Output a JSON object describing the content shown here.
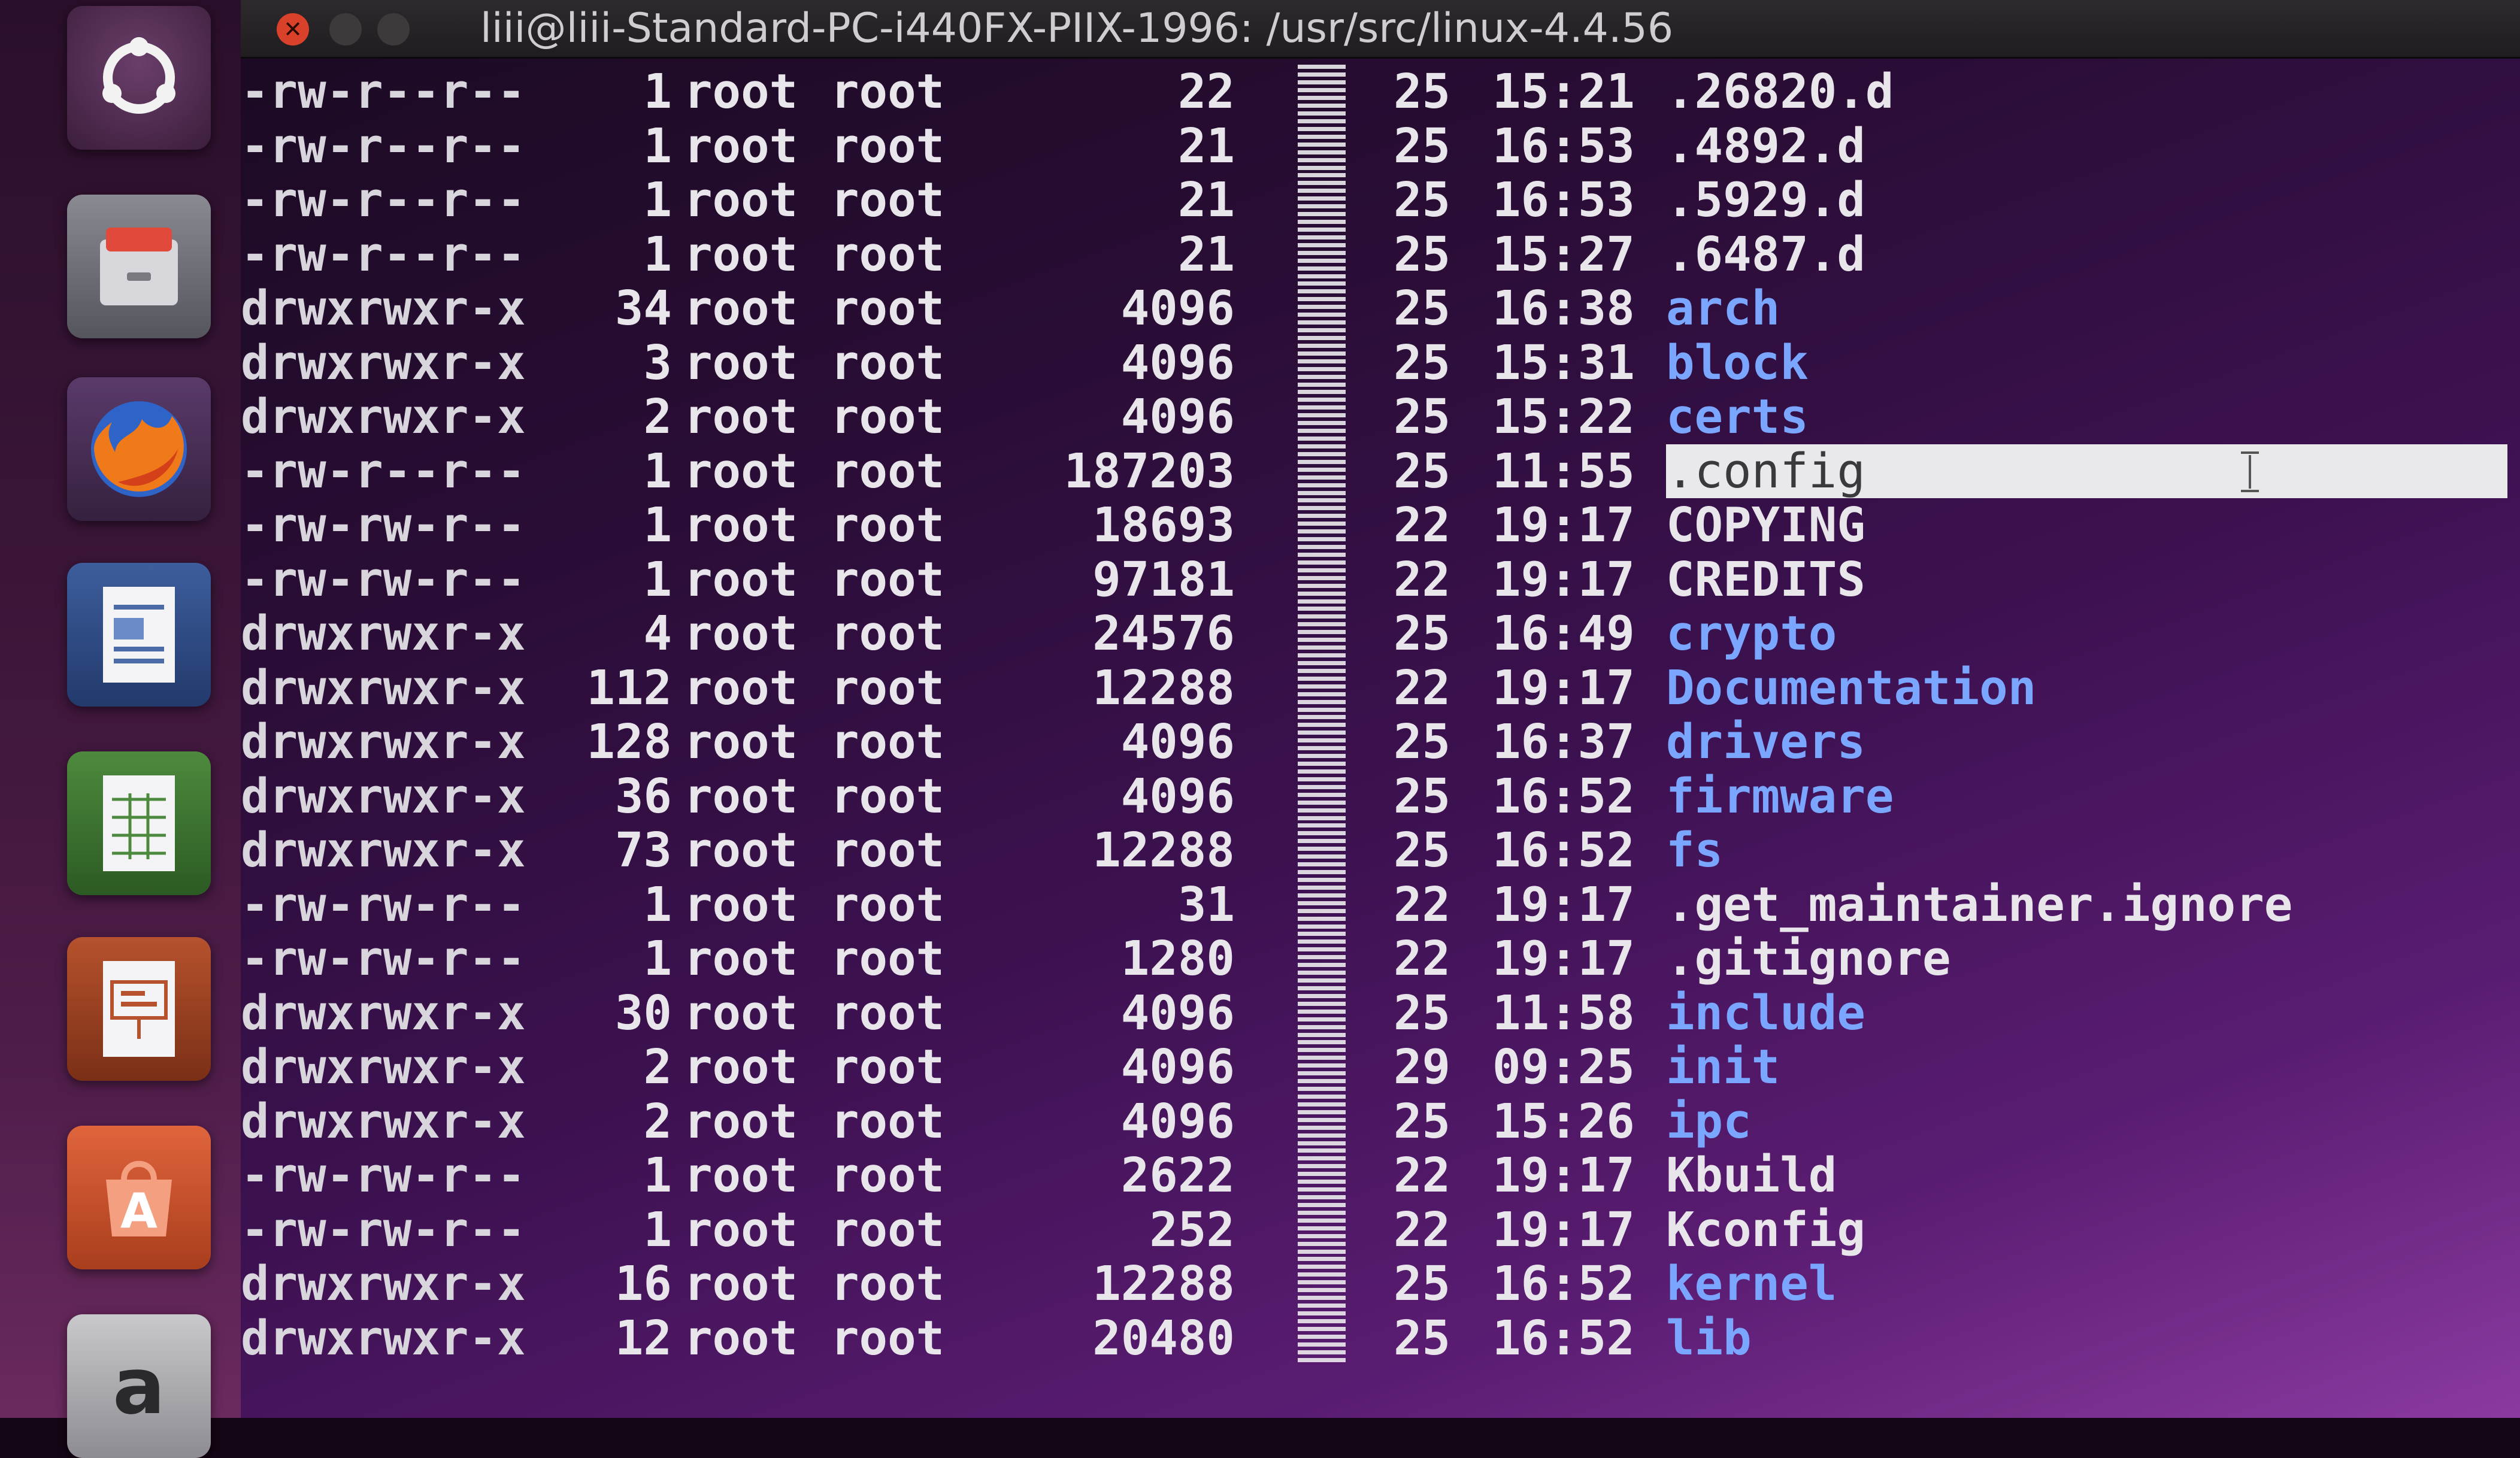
{
  "window": {
    "title": "liii@liii-Standard-PC-i440FX-PIIX-1996: /usr/src/linux-4.4.56",
    "close_glyph": "✕"
  },
  "launcher": {
    "items": [
      {
        "name": "dash-icon"
      },
      {
        "name": "files-icon"
      },
      {
        "name": "firefox-icon"
      },
      {
        "name": "writer-icon"
      },
      {
        "name": "calc-icon"
      },
      {
        "name": "impress-icon"
      },
      {
        "name": "software-center-icon"
      },
      {
        "name": "amazon-icon"
      }
    ]
  },
  "colors": {
    "directory": "#7aa6ff",
    "file": "#e8e6ea",
    "selection_bg": "#e9e9ec"
  },
  "listing": {
    "rows": [
      {
        "perm": "-rw-r--r--",
        "links": "1",
        "owner": "root",
        "group": "root",
        "size": "22",
        "day": "25",
        "time": "15:21",
        "name": ".26820.d",
        "type": "file"
      },
      {
        "perm": "-rw-r--r--",
        "links": "1",
        "owner": "root",
        "group": "root",
        "size": "21",
        "day": "25",
        "time": "16:53",
        "name": ".4892.d",
        "type": "file"
      },
      {
        "perm": "-rw-r--r--",
        "links": "1",
        "owner": "root",
        "group": "root",
        "size": "21",
        "day": "25",
        "time": "16:53",
        "name": ".5929.d",
        "type": "file"
      },
      {
        "perm": "-rw-r--r--",
        "links": "1",
        "owner": "root",
        "group": "root",
        "size": "21",
        "day": "25",
        "time": "15:27",
        "name": ".6487.d",
        "type": "file"
      },
      {
        "perm": "drwxrwxr-x",
        "links": "34",
        "owner": "root",
        "group": "root",
        "size": "4096",
        "day": "25",
        "time": "16:38",
        "name": "arch",
        "type": "dir"
      },
      {
        "perm": "drwxrwxr-x",
        "links": "3",
        "owner": "root",
        "group": "root",
        "size": "4096",
        "day": "25",
        "time": "15:31",
        "name": "block",
        "type": "dir"
      },
      {
        "perm": "drwxrwxr-x",
        "links": "2",
        "owner": "root",
        "group": "root",
        "size": "4096",
        "day": "25",
        "time": "15:22",
        "name": "certs",
        "type": "dir"
      },
      {
        "perm": "-rw-r--r--",
        "links": "1",
        "owner": "root",
        "group": "root",
        "size": "187203",
        "day": "25",
        "time": "11:55",
        "name": ".config",
        "type": "selected"
      },
      {
        "perm": "-rw-rw-r--",
        "links": "1",
        "owner": "root",
        "group": "root",
        "size": "18693",
        "day": "22",
        "time": "19:17",
        "name": "COPYING",
        "type": "file"
      },
      {
        "perm": "-rw-rw-r--",
        "links": "1",
        "owner": "root",
        "group": "root",
        "size": "97181",
        "day": "22",
        "time": "19:17",
        "name": "CREDITS",
        "type": "file"
      },
      {
        "perm": "drwxrwxr-x",
        "links": "4",
        "owner": "root",
        "group": "root",
        "size": "24576",
        "day": "25",
        "time": "16:49",
        "name": "crypto",
        "type": "dir"
      },
      {
        "perm": "drwxrwxr-x",
        "links": "112",
        "owner": "root",
        "group": "root",
        "size": "12288",
        "day": "22",
        "time": "19:17",
        "name": "Documentation",
        "type": "dir"
      },
      {
        "perm": "drwxrwxr-x",
        "links": "128",
        "owner": "root",
        "group": "root",
        "size": "4096",
        "day": "25",
        "time": "16:37",
        "name": "drivers",
        "type": "dir"
      },
      {
        "perm": "drwxrwxr-x",
        "links": "36",
        "owner": "root",
        "group": "root",
        "size": "4096",
        "day": "25",
        "time": "16:52",
        "name": "firmware",
        "type": "dir"
      },
      {
        "perm": "drwxrwxr-x",
        "links": "73",
        "owner": "root",
        "group": "root",
        "size": "12288",
        "day": "25",
        "time": "16:52",
        "name": "fs",
        "type": "dir"
      },
      {
        "perm": "-rw-rw-r--",
        "links": "1",
        "owner": "root",
        "group": "root",
        "size": "31",
        "day": "22",
        "time": "19:17",
        "name": ".get_maintainer.ignore",
        "type": "file"
      },
      {
        "perm": "-rw-rw-r--",
        "links": "1",
        "owner": "root",
        "group": "root",
        "size": "1280",
        "day": "22",
        "time": "19:17",
        "name": ".gitignore",
        "type": "file"
      },
      {
        "perm": "drwxrwxr-x",
        "links": "30",
        "owner": "root",
        "group": "root",
        "size": "4096",
        "day": "25",
        "time": "11:58",
        "name": "include",
        "type": "dir"
      },
      {
        "perm": "drwxrwxr-x",
        "links": "2",
        "owner": "root",
        "group": "root",
        "size": "4096",
        "day": "29",
        "time": "09:25",
        "name": "init",
        "type": "dir"
      },
      {
        "perm": "drwxrwxr-x",
        "links": "2",
        "owner": "root",
        "group": "root",
        "size": "4096",
        "day": "25",
        "time": "15:26",
        "name": "ipc",
        "type": "dir"
      },
      {
        "perm": "-rw-rw-r--",
        "links": "1",
        "owner": "root",
        "group": "root",
        "size": "2622",
        "day": "22",
        "time": "19:17",
        "name": "Kbuild",
        "type": "file"
      },
      {
        "perm": "-rw-rw-r--",
        "links": "1",
        "owner": "root",
        "group": "root",
        "size": "252",
        "day": "22",
        "time": "19:17",
        "name": "Kconfig",
        "type": "file"
      },
      {
        "perm": "drwxrwxr-x",
        "links": "16",
        "owner": "root",
        "group": "root",
        "size": "12288",
        "day": "25",
        "time": "16:52",
        "name": "kernel",
        "type": "dir"
      },
      {
        "perm": "drwxrwxr-x",
        "links": "12",
        "owner": "root",
        "group": "root",
        "size": "20480",
        "day": "25",
        "time": "16:52",
        "name": "lib",
        "type": "dir"
      }
    ]
  }
}
